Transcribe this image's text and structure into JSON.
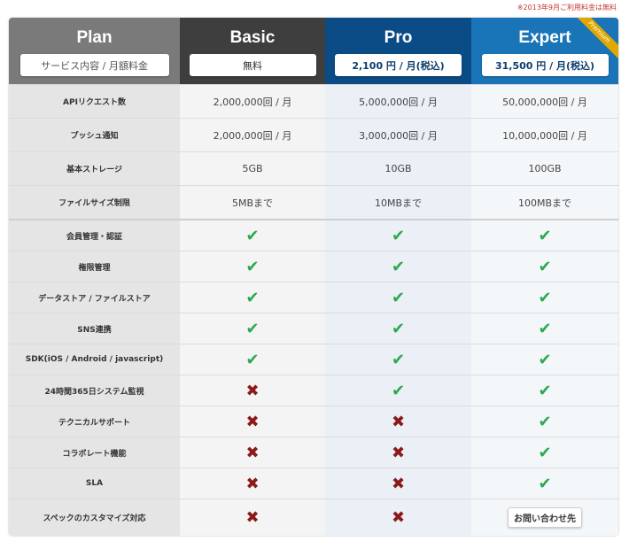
{
  "note": "※2013年9月ご利用料金は無料",
  "header": {
    "plan": {
      "title": "Plan",
      "subtitle": "サービス内容 / 月額料金"
    },
    "basic": {
      "title": "Basic",
      "price": "無料"
    },
    "pro": {
      "title": "Pro",
      "price": "2,100 円 / 月(税込)"
    },
    "expert": {
      "title": "Expert",
      "price": "31,500 円 / 月(税込)",
      "ribbon": "Premium"
    }
  },
  "quota_rows": [
    {
      "label": "APIリクエスト数",
      "basic": "2,000,000回 / 月",
      "pro": "5,000,000回 / 月",
      "expert": "50,000,000回 / 月"
    },
    {
      "label": "プッシュ通知",
      "basic": "2,000,000回 / 月",
      "pro": "3,000,000回 / 月",
      "expert": "10,000,000回 / 月"
    },
    {
      "label": "基本ストレージ",
      "basic": "5GB",
      "pro": "10GB",
      "expert": "100GB"
    },
    {
      "label": "ファイルサイズ制限",
      "basic": "5MBまで",
      "pro": "10MBまで",
      "expert": "100MBまで"
    }
  ],
  "feature_rows": [
    {
      "label": "会員管理・認証",
      "basic": "check",
      "pro": "check",
      "expert": "check"
    },
    {
      "label": "権限管理",
      "basic": "check",
      "pro": "check",
      "expert": "check"
    },
    {
      "label": "データストア / ファイルストア",
      "basic": "check",
      "pro": "check",
      "expert": "check"
    },
    {
      "label": "SNS連携",
      "basic": "check",
      "pro": "check",
      "expert": "check"
    },
    {
      "label": "SDK(iOS / Android / javascript)",
      "basic": "check",
      "pro": "check",
      "expert": "check"
    },
    {
      "label": "24時間365日システム監視",
      "basic": "cross",
      "pro": "check",
      "expert": "check"
    },
    {
      "label": "テクニカルサポート",
      "basic": "cross",
      "pro": "cross",
      "expert": "check"
    },
    {
      "label": "コラボレート機能",
      "basic": "cross",
      "pro": "cross",
      "expert": "check"
    },
    {
      "label": "SLA",
      "basic": "cross",
      "pro": "cross",
      "expert": "check"
    },
    {
      "label": "スペックのカスタマイズ対応",
      "basic": "cross",
      "pro": "cross",
      "expert": "お問い合わせ先"
    }
  ],
  "icons": {
    "check": "✔",
    "cross": "✖"
  },
  "colors": {
    "check": "#2fa84f",
    "cross": "#8b1a1a",
    "pro_header": "#0b4c86",
    "expert_header": "#1a75b8"
  }
}
